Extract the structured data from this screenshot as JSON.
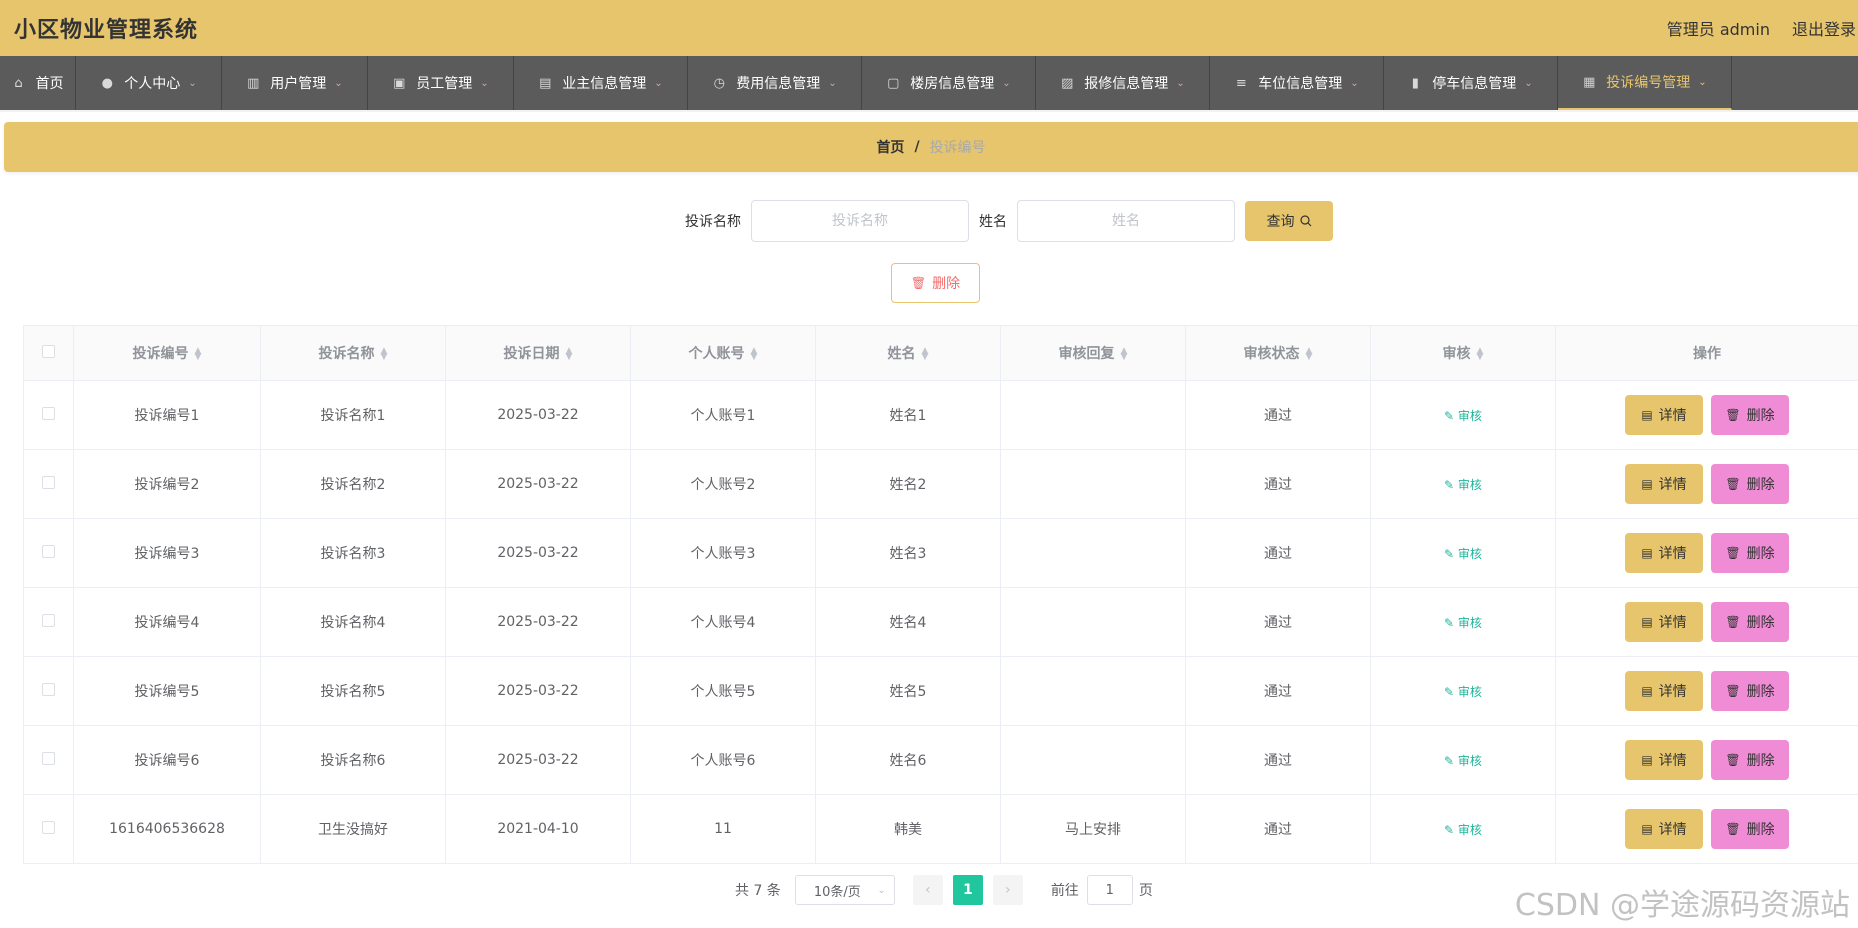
{
  "header": {
    "title": "小区物业管理系统",
    "admin": "管理员 admin",
    "logout": "退出登录"
  },
  "nav": [
    {
      "label": "首页",
      "icon": "home-icon",
      "width": 76,
      "chev": false
    },
    {
      "label": "个人中心",
      "icon": "user-icon",
      "width": 146,
      "chev": true
    },
    {
      "label": "用户管理",
      "icon": "building-icon",
      "width": 146,
      "chev": true
    },
    {
      "label": "员工管理",
      "icon": "clipboard-icon",
      "width": 146,
      "chev": true
    },
    {
      "label": "业主信息管理",
      "icon": "briefcase-icon",
      "width": 174,
      "chev": true
    },
    {
      "label": "费用信息管理",
      "icon": "clock-icon",
      "width": 174,
      "chev": true
    },
    {
      "label": "楼房信息管理",
      "icon": "chat-icon",
      "width": 174,
      "chev": true
    },
    {
      "label": "报修信息管理",
      "icon": "chart-icon",
      "width": 174,
      "chev": true
    },
    {
      "label": "车位信息管理",
      "icon": "list-icon",
      "width": 174,
      "chev": true
    },
    {
      "label": "停车信息管理",
      "icon": "bar-icon",
      "width": 174,
      "chev": true
    },
    {
      "label": "投诉编号管理",
      "icon": "grid-icon",
      "width": 174,
      "chev": true,
      "active": true
    }
  ],
  "breadcrumb": {
    "home": "首页",
    "sep": "/",
    "current": "投诉编号"
  },
  "search": {
    "label1": "投诉名称",
    "placeholder1": "投诉名称",
    "label2": "姓名",
    "placeholder2": "姓名",
    "button": "查询"
  },
  "delete_button": "删除",
  "table": {
    "headers": [
      "投诉编号",
      "投诉名称",
      "投诉日期",
      "个人账号",
      "姓名",
      "审核回复",
      "审核状态",
      "审核",
      "操作"
    ],
    "rows": [
      [
        "投诉编号1",
        "投诉名称1",
        "2025-03-22",
        "个人账号1",
        "姓名1",
        "",
        "通过"
      ],
      [
        "投诉编号2",
        "投诉名称2",
        "2025-03-22",
        "个人账号2",
        "姓名2",
        "",
        "通过"
      ],
      [
        "投诉编号3",
        "投诉名称3",
        "2025-03-22",
        "个人账号3",
        "姓名3",
        "",
        "通过"
      ],
      [
        "投诉编号4",
        "投诉名称4",
        "2025-03-22",
        "个人账号4",
        "姓名4",
        "",
        "通过"
      ],
      [
        "投诉编号5",
        "投诉名称5",
        "2025-03-22",
        "个人账号5",
        "姓名5",
        "",
        "通过"
      ],
      [
        "投诉编号6",
        "投诉名称6",
        "2025-03-22",
        "个人账号6",
        "姓名6",
        "",
        "通过"
      ],
      [
        "1616406536628",
        "卫生没搞好",
        "2021-04-10",
        "11",
        "韩美",
        "马上安排",
        "通过"
      ]
    ],
    "audit_label": "审核",
    "detail_label": "详情",
    "delete_label": "删除"
  },
  "pagination": {
    "total": "共 7 条",
    "page_size": "10条/页",
    "current": "1",
    "goto_prefix": "前往",
    "goto_value": "1",
    "goto_suffix": "页"
  },
  "watermark": "CSDN @学途源码资源站",
  "colors": {
    "accent": "#e7c56c",
    "nav_bg": "#5b5b5b",
    "delete_btn": "#f08bd6",
    "page_active": "#1fc69e",
    "audit": "#1fb59b"
  }
}
